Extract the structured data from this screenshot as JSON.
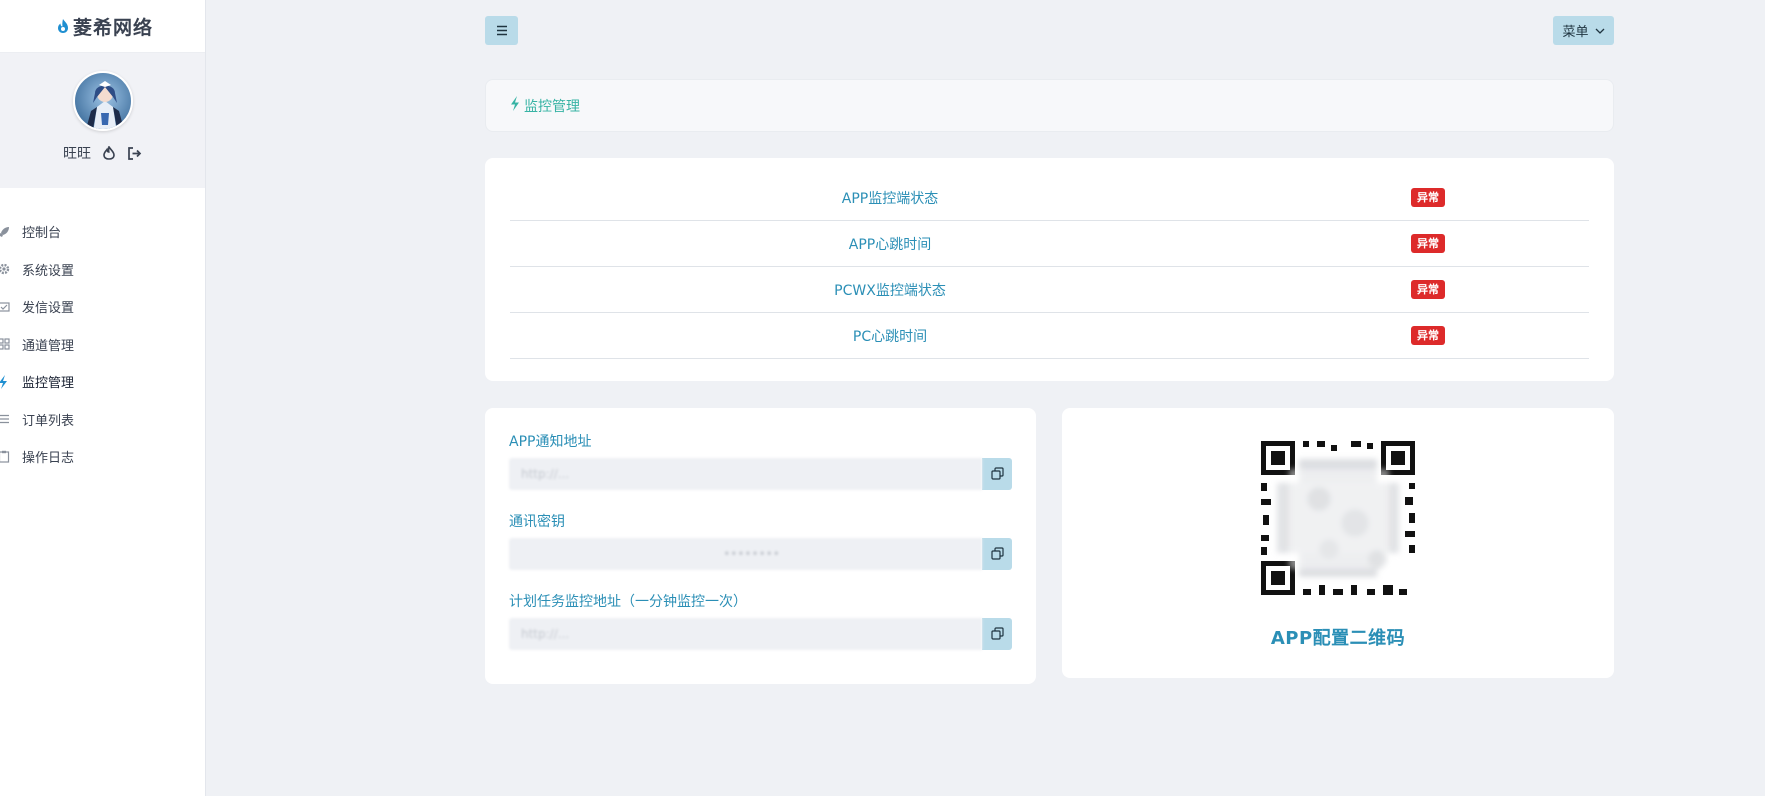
{
  "brand": {
    "name": "菱希网络"
  },
  "user": {
    "name": "旺旺"
  },
  "nav": {
    "items": [
      {
        "label": "控制台",
        "icon": "rocket-icon"
      },
      {
        "label": "系统设置",
        "icon": "gear-icon"
      },
      {
        "label": "发信设置",
        "icon": "mail-check-icon"
      },
      {
        "label": "通道管理",
        "icon": "grid-icon"
      },
      {
        "label": "监控管理",
        "icon": "bolt-icon",
        "active": true
      },
      {
        "label": "订单列表",
        "icon": "list-icon"
      },
      {
        "label": "操作日志",
        "icon": "clipboard-icon"
      }
    ]
  },
  "topbar": {
    "menu_label": "菜单"
  },
  "page": {
    "title": "监控管理"
  },
  "status": {
    "rows": [
      {
        "label": "APP监控端状态",
        "badge": "异常"
      },
      {
        "label": "APP心跳时间",
        "badge": "异常"
      },
      {
        "label": "PCWX监控端状态",
        "badge": "异常"
      },
      {
        "label": "PC心跳时间",
        "badge": "异常"
      }
    ]
  },
  "config": {
    "fields": [
      {
        "label": "APP通知地址",
        "value": "http://..."
      },
      {
        "label": "通讯密钥",
        "value": "••••••••"
      },
      {
        "label": "计划任务监控地址（一分钟监控一次）",
        "value": "http://..."
      }
    ]
  },
  "qr": {
    "caption": "APP配置二维码"
  },
  "colors": {
    "accent": "#2b8fb6",
    "title": "#37b3a4",
    "badge": "#dd2a2a",
    "button": "#b9dbe9",
    "background": "#eff1f5"
  }
}
